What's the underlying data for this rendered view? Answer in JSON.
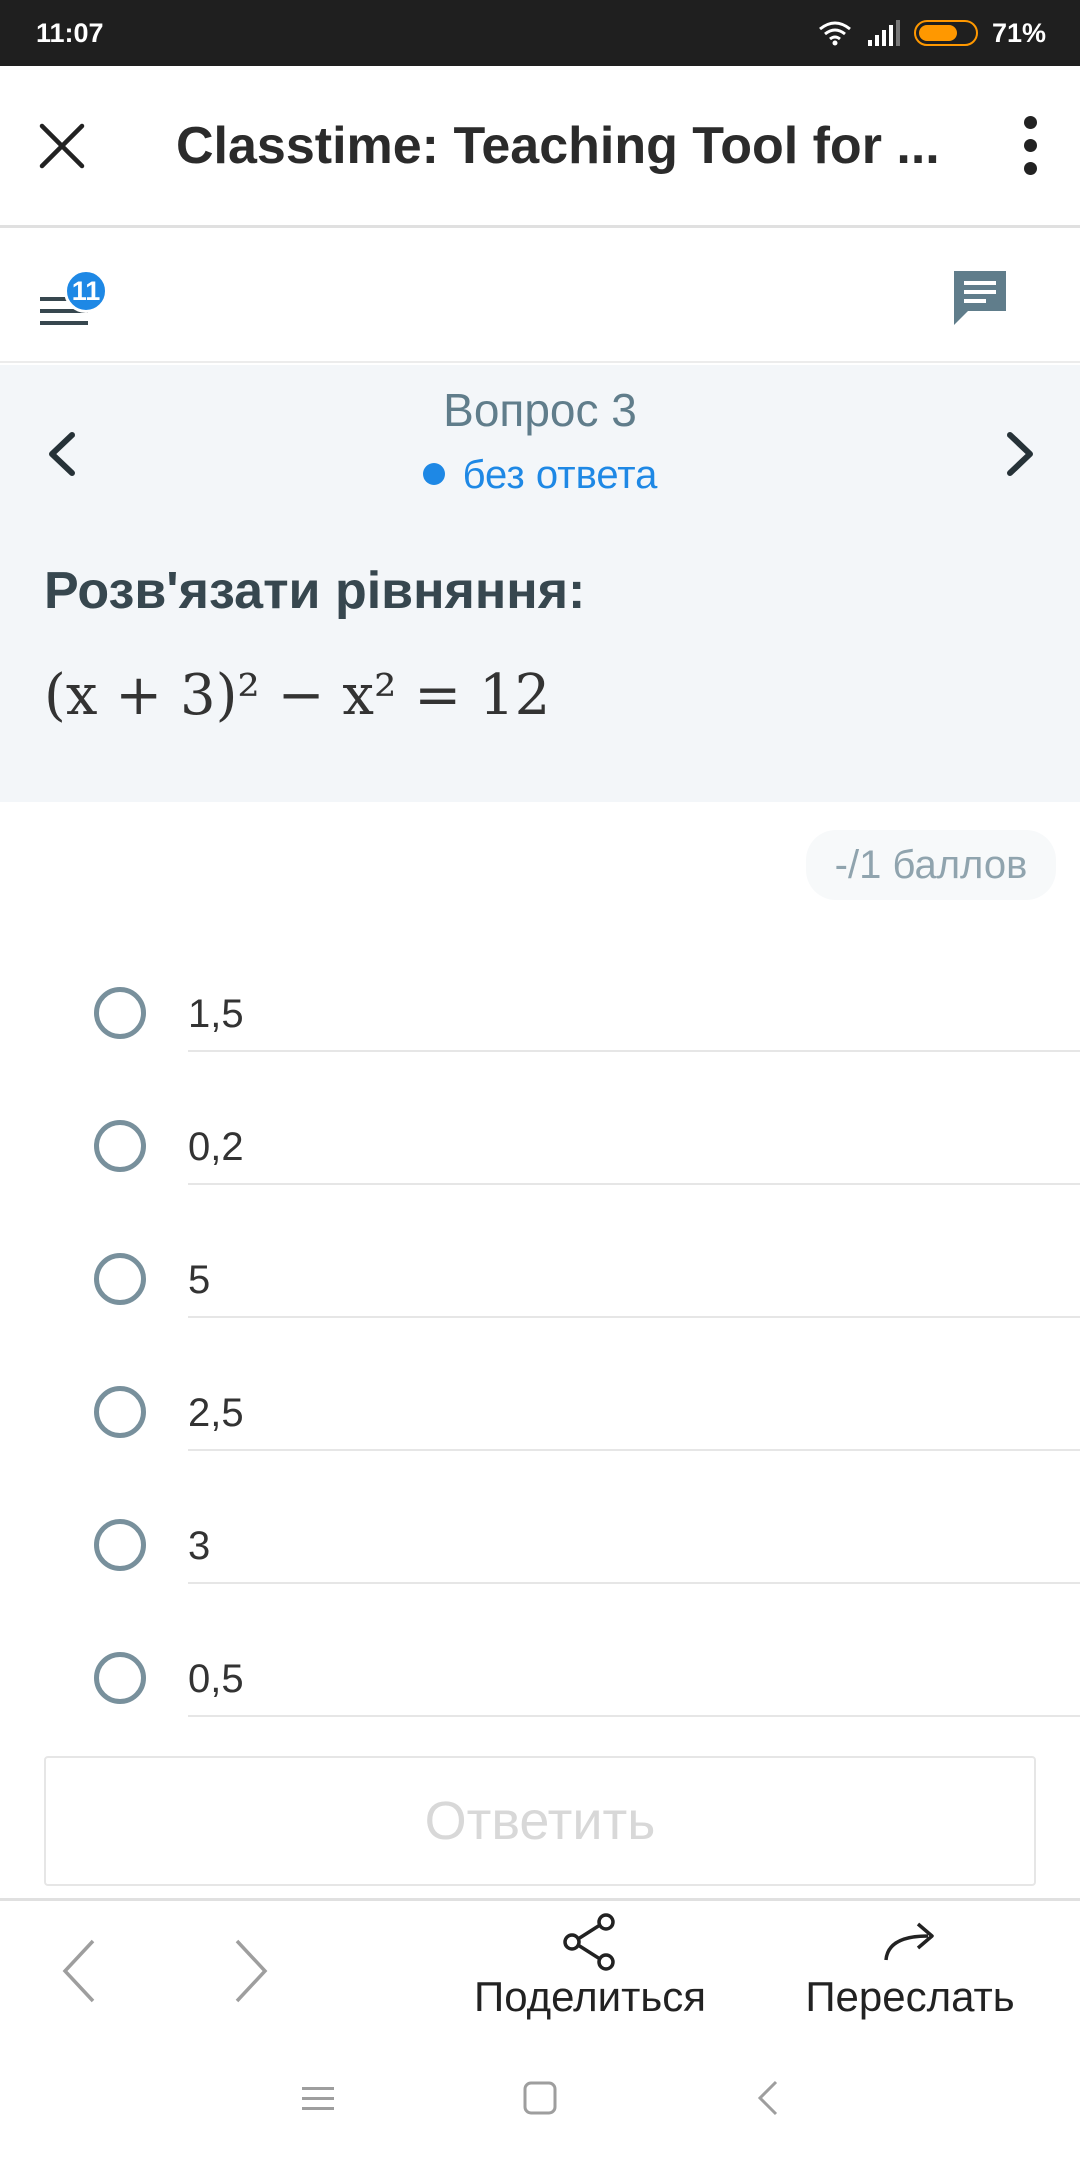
{
  "status_bar": {
    "time": "11:07",
    "battery_percent": "71%",
    "battery_level": 0.71,
    "icons": [
      "wifi-icon",
      "signal-icon",
      "battery-icon"
    ]
  },
  "browser": {
    "title": "Classtime: Teaching Tool for ...",
    "icons": [
      "close-icon",
      "more-vert-icon"
    ]
  },
  "toolbar": {
    "badge_count": "11",
    "icons": [
      "menu-list-icon",
      "chat-icon"
    ]
  },
  "question": {
    "number_label": "Вопрос 3",
    "status_label": "без ответа",
    "status_color": "#1e88e5",
    "prompt": "Розв'язати рівняння:",
    "formula": "(x + 3)² − x² = 12",
    "points_label": "-/1 баллов"
  },
  "options": [
    {
      "label": "1,5"
    },
    {
      "label": "0,2"
    },
    {
      "label": "5"
    },
    {
      "label": "2,5"
    },
    {
      "label": "3"
    },
    {
      "label": "0,5"
    }
  ],
  "answer_button": {
    "label": "Ответить"
  },
  "bottom_bar": {
    "share_label": "Поделиться",
    "forward_label": "Переслать",
    "icons": [
      "back-arrow-icon",
      "forward-arrow-icon",
      "share-icon",
      "forward-icon"
    ]
  },
  "system_nav": {
    "icons": [
      "recents-icon",
      "home-icon",
      "back-icon"
    ]
  }
}
